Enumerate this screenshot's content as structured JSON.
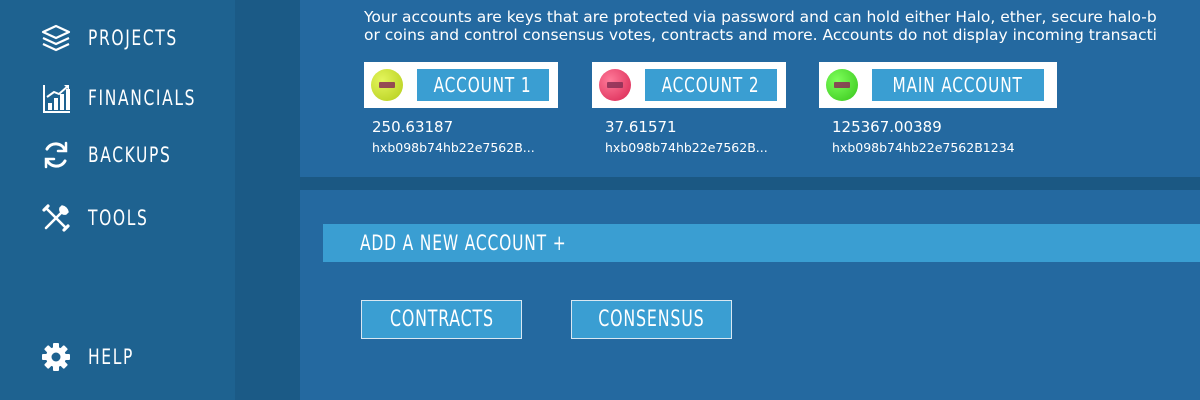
{
  "sidebar": {
    "items": [
      {
        "label": "PROJECTS",
        "icon": "layers-icon"
      },
      {
        "label": "FINANCIALS",
        "icon": "bar-chart-icon"
      },
      {
        "label": "BACKUPS",
        "icon": "refresh-icon"
      },
      {
        "label": "TOOLS",
        "icon": "tools-icon"
      },
      {
        "label": "HELP",
        "icon": "gear-icon"
      }
    ]
  },
  "intro": {
    "line1": "Your accounts are keys that are protected via password and can hold either Halo, ether, secure halo-b",
    "line2": "or coins and control consensus votes, contracts and more. Accounts do not display incoming transacti"
  },
  "accounts": [
    {
      "name": "ACCOUNT 1",
      "balance": "250.63187",
      "address": "hxb098b74hb22e7562B...",
      "coin_color": "#c6e02a"
    },
    {
      "name": "ACCOUNT 2",
      "balance": "37.61571",
      "address": "hxb098b74hb22e7562B...",
      "coin_color": "#e83a6a"
    },
    {
      "name": "MAIN ACCOUNT",
      "balance": "125367.00389",
      "address": "hxb098b74hb22e7562B1234",
      "coin_color": "#4cd62e"
    }
  ],
  "add_account": {
    "label": "ADD A NEW ACCOUNT +"
  },
  "actions": {
    "contracts": "CONTRACTS",
    "consensus": "CONSENSUS"
  },
  "colors": {
    "background": "#1d5f8d",
    "panel": "#2469a0",
    "accent": "#3a9ed2"
  }
}
